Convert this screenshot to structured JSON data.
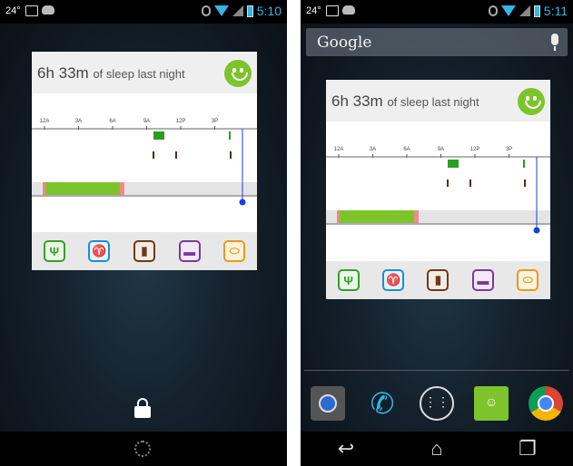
{
  "left_screen": {
    "status": {
      "temperature": "24°",
      "time": "5:10"
    },
    "widget": {
      "sleep_value": "6h 33m",
      "sleep_suffix": "of sleep last night"
    },
    "lock_icon": "lock-icon"
  },
  "right_screen": {
    "status": {
      "temperature": "24°",
      "time": "5:11"
    },
    "search": {
      "label": "Google"
    },
    "widget": {
      "sleep_value": "6h 33m",
      "sleep_suffix": "of sleep last night"
    },
    "dock": [
      "camera-icon",
      "phone-icon",
      "app-drawer-icon",
      "messaging-icon",
      "chrome-icon"
    ],
    "nav": [
      "back-button",
      "home-button",
      "recents-button"
    ]
  },
  "timeline": {
    "tick_labels": [
      "12A",
      "3A",
      "6A",
      "9A",
      "12P",
      "3P"
    ],
    "activity_icons": [
      "food-icon",
      "exercise-icon",
      "coffee-icon",
      "smoking-icon",
      "medication-icon"
    ],
    "colors": {
      "sleep": "#7dc42c",
      "activity": "#2a9e1f",
      "coffee": "#5a2a1a",
      "now": "#1a3ee6",
      "wake": "#f08a8a"
    }
  }
}
